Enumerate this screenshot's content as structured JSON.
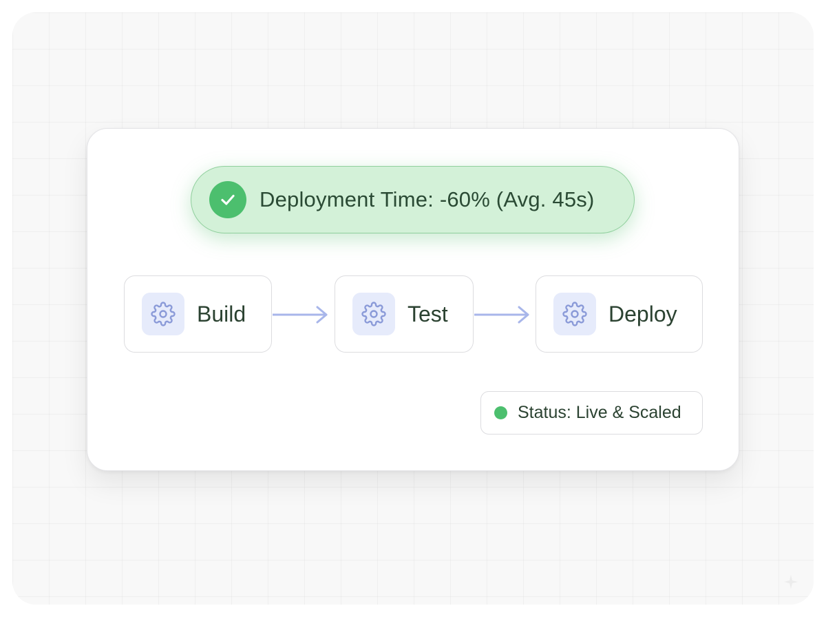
{
  "metric": {
    "text": "Deployment Time: -60% (Avg. 45s)",
    "icon": "check-circle-icon",
    "color": "#4cbf6e"
  },
  "pipeline": {
    "stages": [
      {
        "label": "Build",
        "icon": "gear-icon"
      },
      {
        "label": "Test",
        "icon": "gear-icon"
      },
      {
        "label": "Deploy",
        "icon": "gear-icon"
      }
    ],
    "connector_icon": "arrow-right-icon",
    "accent": "#a8b6ea"
  },
  "status": {
    "text": "Status: Live & Scaled",
    "indicator_color": "#4cbf6e"
  }
}
